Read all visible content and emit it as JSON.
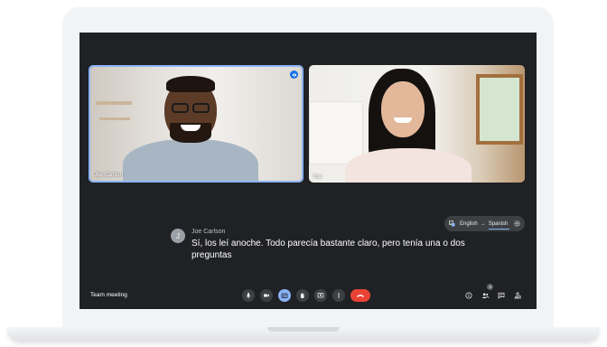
{
  "participants": [
    {
      "name": "Joe Carlson",
      "speaking": true
    },
    {
      "name": "You",
      "speaking": false
    }
  ],
  "translation": {
    "source": "English",
    "target": "Spanish",
    "arrow": "→"
  },
  "caption": {
    "speaker": "Joe Carlson",
    "initial": "J",
    "text": "Sí, los leí anoche. Todo parecía bastante claro, pero tenía una o dos preguntas"
  },
  "meeting": {
    "title": "Team meeting"
  },
  "people_count": "3",
  "colors": {
    "screen_bg": "#202124",
    "accent_blue": "#8ab4f8",
    "end_call_red": "#ea4335",
    "control_bg": "#3c4043"
  }
}
